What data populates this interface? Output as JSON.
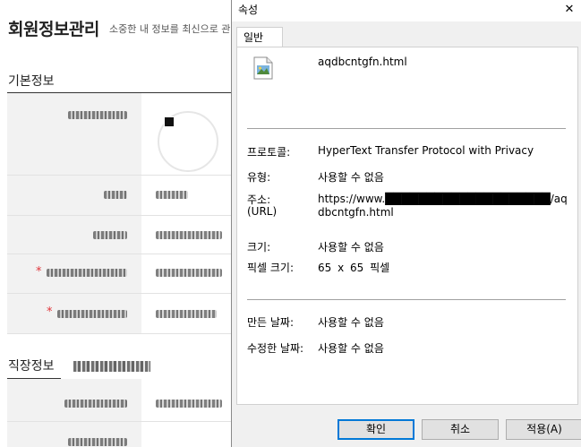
{
  "background_page": {
    "title": "회원정보관리",
    "description": "소중한 내 정보를 최신으로 관",
    "section_basic": "기본정보",
    "section_work": "직장정보",
    "required_mark": "*"
  },
  "dialog": {
    "title": "속성",
    "close_glyph": "✕",
    "tab_general": "일반",
    "file_name": "aqdbcntgfn.html",
    "properties": [
      {
        "label": "프로토콜:",
        "value": "HyperText Transfer Protocol with Privacy"
      },
      {
        "label": "유형:",
        "value": "사용할 수 없음"
      },
      {
        "label": "주소:",
        "label2": "(URL)",
        "value": "https://www.████████████████████/aqdbcntgfn.html"
      },
      {
        "label": "크기:",
        "value": "사용할 수 없음"
      },
      {
        "label": "픽셀 크기:",
        "value": "65 x 65 픽셀"
      },
      {
        "label": "만든 날짜:",
        "value": "사용할 수 없음"
      },
      {
        "label": "수정한 날짜:",
        "value": "사용할 수 없음"
      }
    ],
    "buttons": {
      "ok": "확인",
      "cancel": "취소",
      "apply": "적용(A)"
    },
    "icons": {
      "file": "html-file-icon",
      "close": "close-icon"
    },
    "colors": {
      "dialog_bg": "#f0f0f0",
      "focus_border": "#0078d7"
    }
  }
}
